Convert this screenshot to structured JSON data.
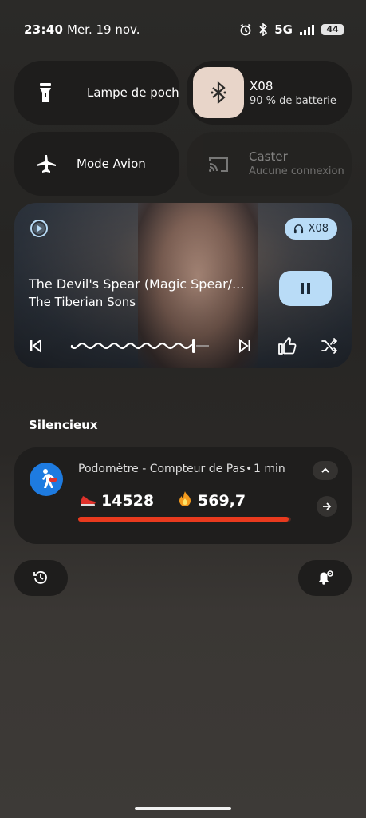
{
  "status_bar": {
    "time": "23:40",
    "date": "Mer. 19 nov.",
    "network": "5G",
    "battery": "44",
    "icons": [
      "alarm-icon",
      "bluetooth-icon",
      "signal-icon"
    ]
  },
  "tiles": {
    "flashlight": {
      "label": "Lampe de poche",
      "icon": "flashlight-icon"
    },
    "bluetooth": {
      "label": "X08",
      "sub": "90 % de batterie",
      "icon": "bluetooth-icon"
    },
    "airplane": {
      "label": "Mode Avion",
      "icon": "airplane-icon"
    },
    "cast": {
      "label": "Caster",
      "sub": "Aucune connexion",
      "icon": "cast-icon"
    }
  },
  "media": {
    "title": "The Devil's Spear (Magic Spear/...",
    "artist": "The Tiberian Sons",
    "output_device": "X08",
    "progress": 0.88,
    "icons": [
      "app-icon",
      "headphones-icon",
      "pause-icon",
      "previous-icon",
      "next-icon",
      "thumbs-up-icon",
      "shuffle-icon"
    ]
  },
  "section_title": "Silencieux",
  "notification": {
    "app": "Podomètre - Compteur de Pas",
    "time": "1 min",
    "steps": "14528",
    "calories": "569,7",
    "progress": 0.99
  },
  "colors": {
    "accent": "#b9dcf7",
    "progress": "#e83a1e"
  }
}
